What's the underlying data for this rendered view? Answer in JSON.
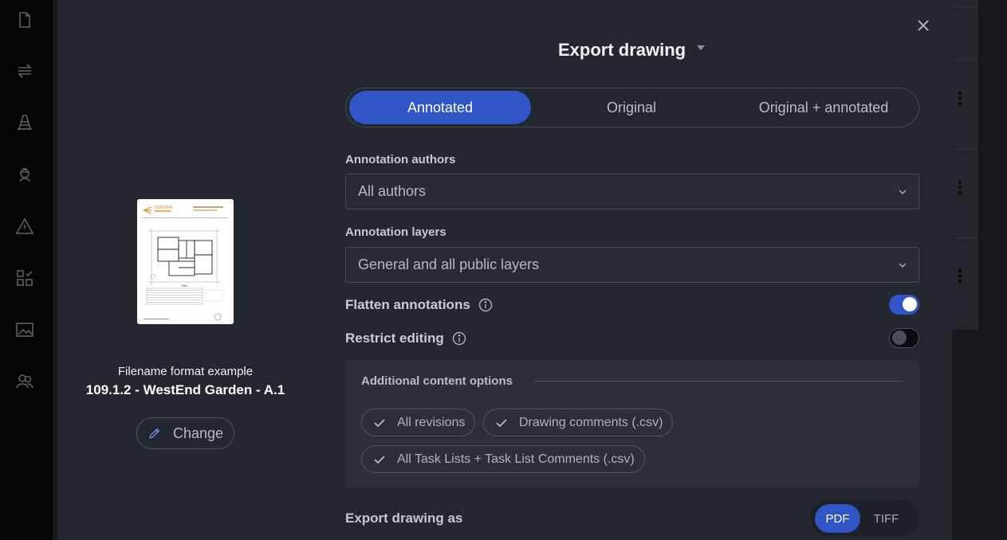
{
  "modal": {
    "title": "Export drawing",
    "close_icon": "close-icon",
    "modes": [
      {
        "label": "Annotated",
        "active": true
      },
      {
        "label": "Original",
        "active": false
      },
      {
        "label": "Original + annotated",
        "active": false
      }
    ],
    "authors": {
      "label": "Annotation authors",
      "value": "All authors"
    },
    "layers": {
      "label": "Annotation layers",
      "value": "General and all public layers"
    },
    "flatten": {
      "label": "Flatten annotations",
      "enabled": true
    },
    "restrict": {
      "label": "Restrict editing",
      "enabled": false
    },
    "additional": {
      "title": "Additional content options",
      "options": [
        {
          "label": "All revisions",
          "checked": true
        },
        {
          "label": "Drawing comments (.csv)",
          "checked": true
        },
        {
          "label": "All Task Lists + Task List Comments (.csv)",
          "checked": true
        }
      ]
    },
    "export_as": {
      "label": "Export drawing as",
      "formats": [
        {
          "label": "PDF",
          "active": true
        },
        {
          "label": "TIFF",
          "active": false
        }
      ]
    },
    "preview": {
      "caption": "Filename format example",
      "example": "109.1.2 - WestEnd Garden - A.1",
      "change_label": "Change",
      "thumbnail_brand": "SONOMA"
    }
  },
  "colors": {
    "accent": "#2f55c6",
    "modal_bg": "#232730",
    "sidebar_bg": "#050505"
  },
  "sidebar": {
    "icons": [
      "document-icon",
      "transfer-icon",
      "cone-icon",
      "worker-icon",
      "warning-icon",
      "checklist-icon",
      "image-icon",
      "team-icon"
    ]
  }
}
